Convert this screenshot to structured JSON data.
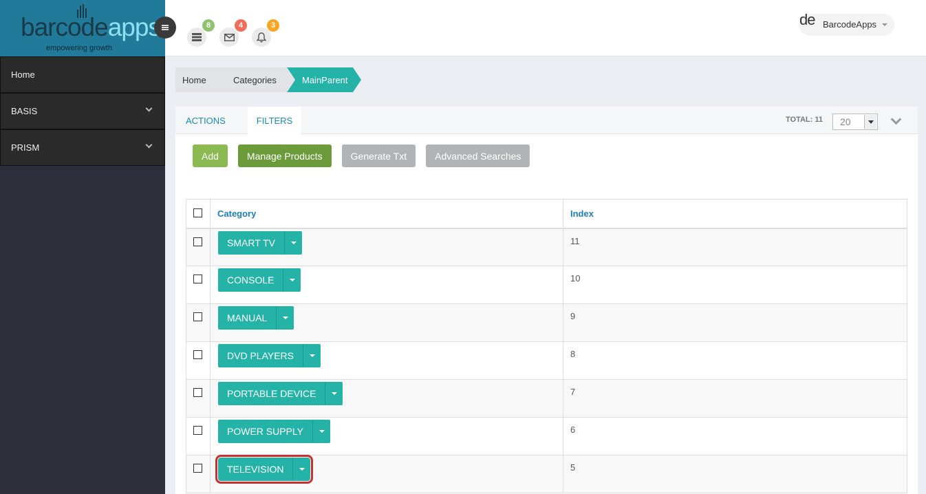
{
  "brand": {
    "logo_part1": "barcode",
    "logo_part2": "apps",
    "tagline": "empowering growth"
  },
  "sidebar": {
    "items": [
      {
        "label": "Home",
        "expandable": false
      },
      {
        "label": "BASIS",
        "expandable": true
      },
      {
        "label": "PRISM",
        "expandable": true
      }
    ]
  },
  "topbar": {
    "icons": [
      {
        "icon": "list-icon",
        "badge": "8",
        "badge_color": "#8dc26f"
      },
      {
        "icon": "mail-icon",
        "badge": "4",
        "badge_color": "#f26c5a"
      },
      {
        "icon": "bell-icon",
        "badge": "3",
        "badge_color": "#f5a623"
      }
    ],
    "user": {
      "avatar_text": "de",
      "name": "BarcodeApps"
    }
  },
  "breadcrumb": [
    "Home",
    "Categories",
    "MainParent"
  ],
  "panel": {
    "tabs": [
      "ACTIONS",
      "FILTERS"
    ],
    "total_label": "TOTAL: 11",
    "page_size": "20",
    "actions": [
      "Add",
      "Manage Products",
      "Generate Txt",
      "Advanced Searches"
    ]
  },
  "table": {
    "headers": [
      "Category",
      "Index"
    ],
    "rows": [
      {
        "category": "SMART TV",
        "index": "11"
      },
      {
        "category": "CONSOLE",
        "index": "10"
      },
      {
        "category": "MANUAL",
        "index": "9"
      },
      {
        "category": "DVD PLAYERS",
        "index": "8"
      },
      {
        "category": "PORTABLE DEVICE",
        "index": "7"
      },
      {
        "category": "POWER SUPPLY",
        "index": "6"
      },
      {
        "category": "TELEVISION",
        "index": "5"
      }
    ]
  },
  "colors": {
    "accent": "#25b3a8",
    "sidebar": "#2d2e3a",
    "logo_bg": "#217a9a",
    "link": "#1a8ab5",
    "highlight": "#c9302c"
  }
}
